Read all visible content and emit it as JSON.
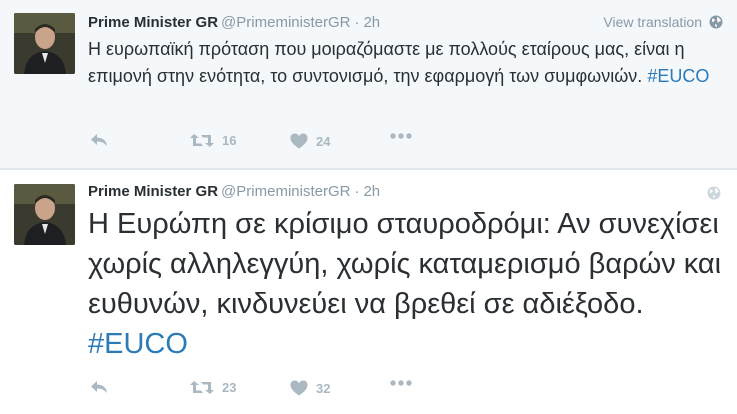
{
  "tweets": [
    {
      "name": "Prime Minister GR",
      "handle": "@PrimeministerGR",
      "separator": "·",
      "time": "2h",
      "translate_label": "View translation",
      "text": "Η ευρωπαϊκή πρόταση που μοιραζόμαστε με πολλούς εταίρους μας, είναι η επιμονή στην ενότητα, το συντονισμό, την εφαρμογή των συμφωνιών.",
      "hashtag": "#EUCO",
      "retweets": "16",
      "likes": "24"
    },
    {
      "name": "Prime Minister GR",
      "handle": "@PrimeministerGR",
      "separator": "·",
      "time": "2h",
      "text": "Η Ευρώπη σε κρίσιμο σταυροδρόμι: Αν συνεχίσει χωρίς αλληλεγγύη, χωρίς καταμερισμό βαρών και ευθυνών, κινδυνεύει να βρεθεί σε αδιέξοδο.",
      "hashtag": "#EUCO",
      "retweets": "23",
      "likes": "32"
    }
  ],
  "icons": {
    "reply": "reply-icon",
    "retweet": "retweet-icon",
    "like": "heart-icon",
    "more": "more-icon",
    "globe": "globe-icon"
  },
  "colors": {
    "hashtag": "#2b7bb9",
    "muted": "#8899a6",
    "action": "#aab8c2",
    "highlight_bg": "#f5f8fa"
  }
}
